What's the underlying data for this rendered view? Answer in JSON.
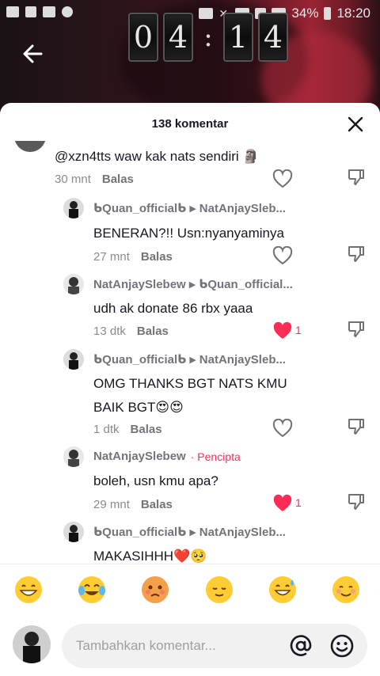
{
  "status_bar": {
    "battery": "34%",
    "time": "18:20"
  },
  "timer": {
    "digits": [
      "0",
      "4",
      ":",
      "1",
      "4"
    ]
  },
  "sheet": {
    "title": "138 komentar"
  },
  "comments": [
    {
      "id": "c1",
      "username": "",
      "text": "@xzn4tts waw kak nats sendiri 🗿",
      "time": "30 mnt",
      "reply_label": "Balas",
      "liked": false,
      "likes": ""
    },
    {
      "id": "c2",
      "username": "ᑲQuan_officialᑲ",
      "reply_to": "NatAnjaySleb...",
      "text": "BENERAN?!! Usn:nyanyaminya",
      "time": "27 mnt",
      "reply_label": "Balas",
      "liked": false,
      "likes": ""
    },
    {
      "id": "c3",
      "username": "NatAnjaySlebew",
      "reply_to": "ᑲQuan_official...",
      "text": "udh ak donate 86 rbx yaaa",
      "time": "13 dtk",
      "reply_label": "Balas",
      "liked": true,
      "likes": "1"
    },
    {
      "id": "c4",
      "username": "ᑲQuan_officialᑲ",
      "reply_to": "NatAnjaySleb...",
      "text_line1": "OMG THANKS BGT NATS KMU",
      "text_line2": "BAIK BGT😍😍",
      "time": "1 dtk",
      "reply_label": "Balas",
      "liked": false,
      "likes": ""
    },
    {
      "id": "c5",
      "username": "NatAnjaySlebew",
      "creator_badge": "Pencipta",
      "text": "boleh, usn kmu apa?",
      "time": "29 mnt",
      "reply_label": "Balas",
      "liked": true,
      "likes": "1"
    },
    {
      "id": "c6",
      "username": "ᑲQuan_officialᑲ",
      "reply_to": "NatAnjaySleb...",
      "text": "MAKASIHHH❤️🥺"
    }
  ],
  "emoji_bar": [
    "grinning-emoji",
    "joy-emoji",
    "pouting-emoji",
    "relieved-emoji",
    "sweat-smile-emoji",
    "smiling-emoji"
  ],
  "composer": {
    "placeholder": "Tambahkan komentar..."
  },
  "colors": {
    "accent": "#fe2c55",
    "meta": "#8a8b91",
    "text": "#161823"
  }
}
